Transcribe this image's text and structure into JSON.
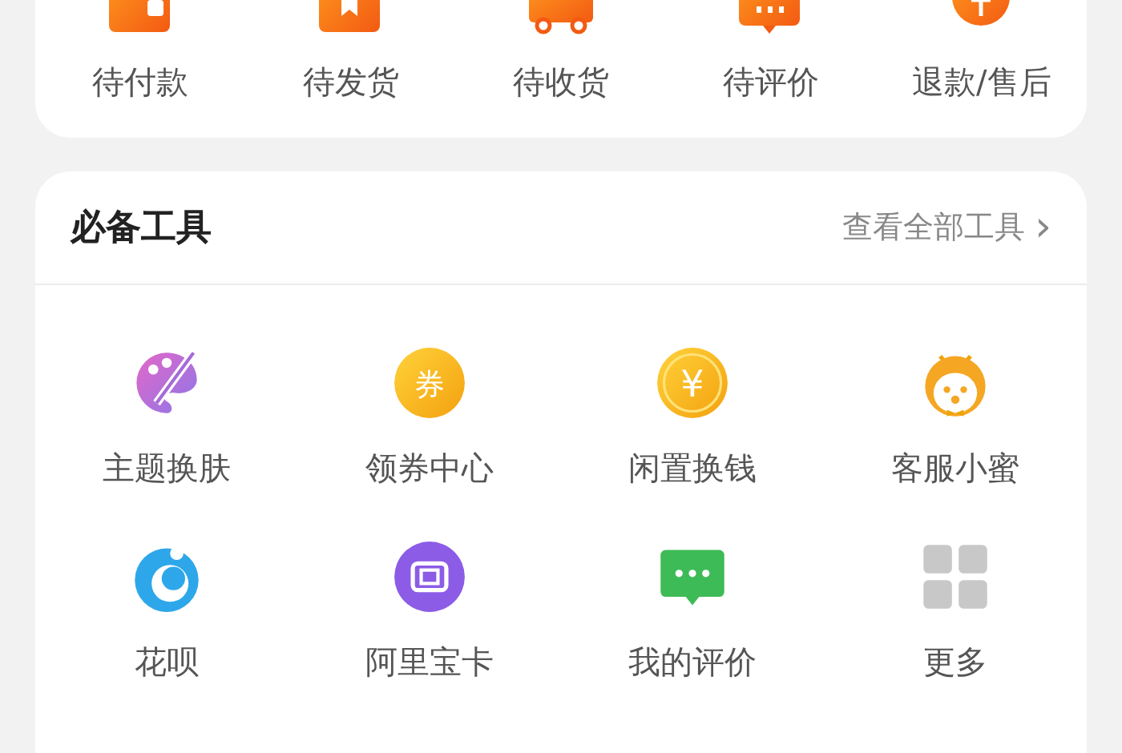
{
  "order_shortcuts": [
    {
      "kind": "wallet",
      "label": "待付款"
    },
    {
      "kind": "box",
      "label": "待发货"
    },
    {
      "kind": "truck",
      "label": "待收货"
    },
    {
      "kind": "chat",
      "label": "待评价"
    },
    {
      "kind": "refund",
      "label": "退款/售后"
    }
  ],
  "tools": {
    "title": "必备工具",
    "view_all": "查看全部工具",
    "chevron": "›",
    "items": [
      {
        "kind": "palette",
        "label": "主题换肤"
      },
      {
        "kind": "coupon",
        "label": "领券中心",
        "glyph": "券"
      },
      {
        "kind": "coin",
        "label": "闲置换钱",
        "glyph": "¥"
      },
      {
        "kind": "bee",
        "label": "客服小蜜"
      },
      {
        "kind": "huabei",
        "label": "花呗"
      },
      {
        "kind": "card",
        "label": "阿里宝卡"
      },
      {
        "kind": "review",
        "label": "我的评价"
      },
      {
        "kind": "grid",
        "label": "更多"
      }
    ]
  }
}
